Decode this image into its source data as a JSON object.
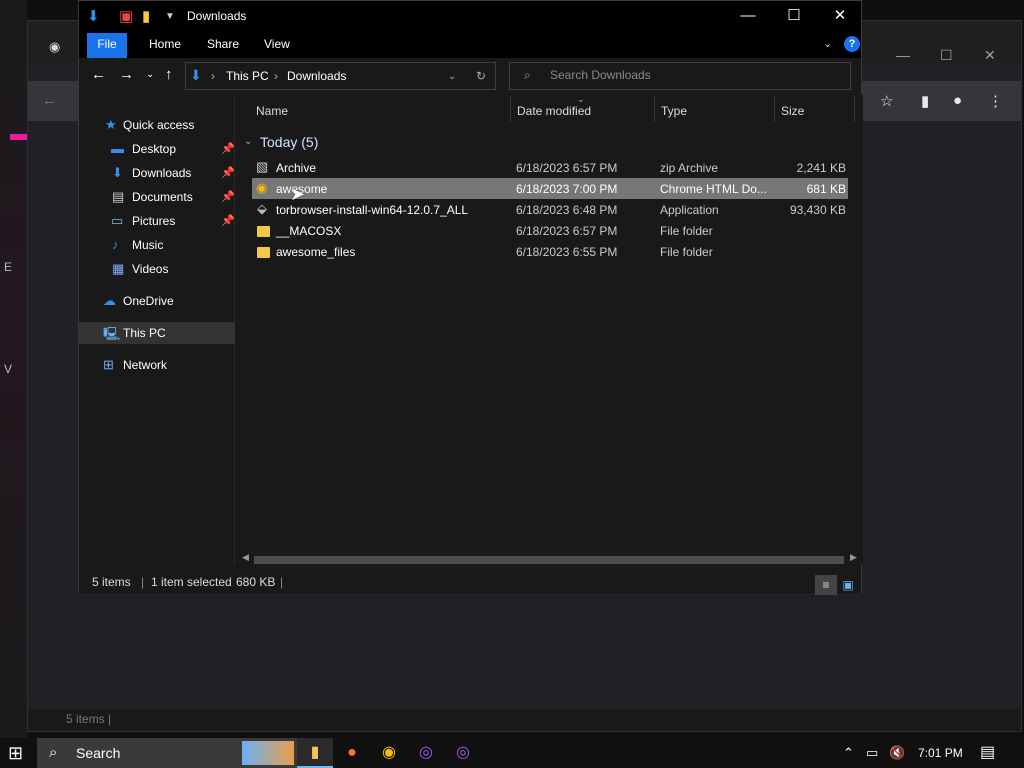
{
  "background": {
    "status_text": "5 items |",
    "edge_letters": [
      "E",
      "V"
    ]
  },
  "explorer": {
    "title": "Downloads",
    "ribbon": {
      "tabs": [
        "File",
        "Home",
        "Share",
        "View"
      ]
    },
    "address": {
      "segments": [
        "This PC",
        "Downloads"
      ]
    },
    "search": {
      "placeholder": "Search Downloads"
    },
    "nav": {
      "quick_access": "Quick access",
      "items": [
        {
          "label": "Desktop",
          "pinned": true,
          "icon": "desktop-icon"
        },
        {
          "label": "Downloads",
          "pinned": true,
          "icon": "download-icon"
        },
        {
          "label": "Documents",
          "pinned": true,
          "icon": "documents-icon"
        },
        {
          "label": "Pictures",
          "pinned": true,
          "icon": "pictures-icon"
        },
        {
          "label": "Music",
          "pinned": false,
          "icon": "music-icon"
        },
        {
          "label": "Videos",
          "pinned": false,
          "icon": "videos-icon"
        }
      ],
      "onedrive": "OneDrive",
      "this_pc": "This PC",
      "network": "Network"
    },
    "columns": {
      "name": "Name",
      "date": "Date modified",
      "type": "Type",
      "size": "Size"
    },
    "group": "Today (5)",
    "files": [
      {
        "name": "Archive",
        "date": "6/18/2023 6:57 PM",
        "type": "zip Archive",
        "size": "2,241 KB",
        "icon": "zip-icon"
      },
      {
        "name": "awesome",
        "date": "6/18/2023 7:00 PM",
        "type": "Chrome HTML Do...",
        "size": "681 KB",
        "icon": "chrome-icon",
        "selected": true
      },
      {
        "name": "torbrowser-install-win64-12.0.7_ALL",
        "date": "6/18/2023 6:48 PM",
        "type": "Application",
        "size": "93,430 KB",
        "icon": "installer-icon"
      },
      {
        "name": "__MACOSX",
        "date": "6/18/2023 6:57 PM",
        "type": "File folder",
        "size": "",
        "icon": "folder-icon"
      },
      {
        "name": "awesome_files",
        "date": "6/18/2023 6:55 PM",
        "type": "File folder",
        "size": "",
        "icon": "folder-icon"
      }
    ],
    "status": {
      "count": "5 items",
      "selected": "1 item selected",
      "size": "680 KB"
    }
  },
  "taskbar": {
    "search_label": "Search",
    "time": "7:01 PM"
  },
  "colors": {
    "accent": "#1a73e8",
    "selection": "#777777",
    "folder": "#f5c84c"
  }
}
